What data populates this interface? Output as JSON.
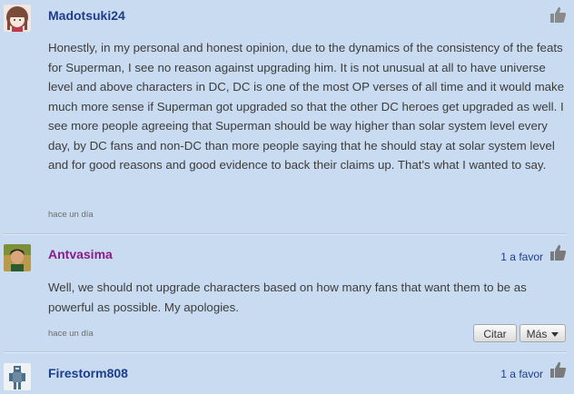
{
  "comments": [
    {
      "username": "Madotsuki24",
      "avatar_icon": "girl-avatar-icon",
      "text": "Honestly, in my personal and honest opinion, due to the dynamics of the consistency of the feats for Superman, I see no reason against upgrading him. It is not unusual at all to have universe level and above characters in DC, DC is one of the most OP verses of all time and it would make much more sense if Superman got upgraded so that the other DC heroes get upgraded as well. I see more people agreeing that Superman should be way higher than solar system level every day, by DC fans and non-DC than more people saying that he should stay at solar system level and for good reasons and good evidence to back their claims up. That's what I wanted to say.",
      "timestamp": "hace un día",
      "likes": ""
    },
    {
      "username": "Antvasima",
      "avatar_icon": "man-avatar-icon",
      "text": "Well, we should not upgrade characters based on how many fans that want them to be as powerful as possible. My apologies.",
      "timestamp": "hace un día",
      "likes": "1 a favor",
      "quote_label": "Citar",
      "more_label": "Más"
    },
    {
      "username": "Firestorm808",
      "avatar_icon": "robot-avatar-icon",
      "likes": "1 a favor"
    }
  ],
  "colors": {
    "background": "#c9dbf0",
    "username_blue": "#1d3d8a",
    "username_purple": "#8b1a8b"
  }
}
